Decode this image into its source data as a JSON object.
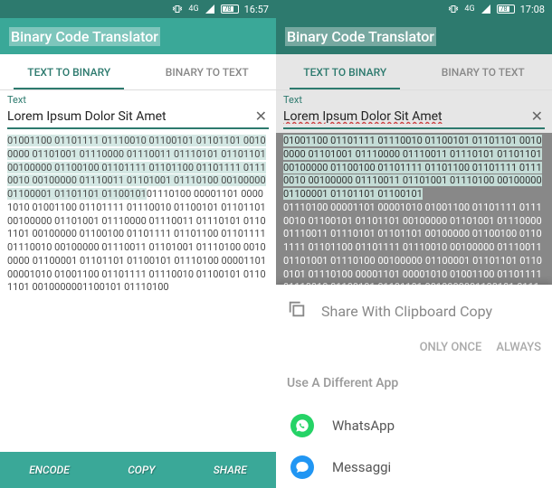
{
  "status": {
    "network": "4G",
    "battery": "78",
    "time_left": "16:57",
    "time_right": "17:08"
  },
  "app": {
    "title": "Binary Code Translator"
  },
  "tabs": {
    "text_to_binary": "TEXT TO BINARY",
    "binary_to_text": "BINARY TO TEXT"
  },
  "input": {
    "label": "Text",
    "value": "Lorem Ipsum Dolor Sit Amet"
  },
  "output": {
    "binary_p1": "01001100 01101111 01110010 01100101 01101101 00100000 01101001 01110000 01110011 01110101 01101101 00100000 01100100 01101111 01101100 01101111 01110010 00100000 01110011 01101001 01110100 00100000 01100001 01101101 01100101",
    "binary_p2": "01110100 00001101 00001010 01001100 01101111 01110010 01100101 01101101 00100000 01101001 01110000 01110011 01110101 01101101 00100000 01100100 01101111 01101100 01101111 01110010 00100000 01110011 01101001 01110100 00100000",
    "binary_p3": "01100001 01101101 01100101 01110100 00001101 00001010 01001100 01101111 01110010 01100101 01101101 00100000",
    "binary_p4": "01100101 01110100"
  },
  "bottom": {
    "encode": "ENCODE",
    "copy": "COPY",
    "share": "SHARE"
  },
  "share": {
    "title": "Share With Clipboard Copy",
    "only_once": "ONLY ONCE",
    "always": "ALWAYS",
    "different": "Use A Different App",
    "whatsapp": "WhatsApp",
    "messaggi": "Messaggi"
  }
}
